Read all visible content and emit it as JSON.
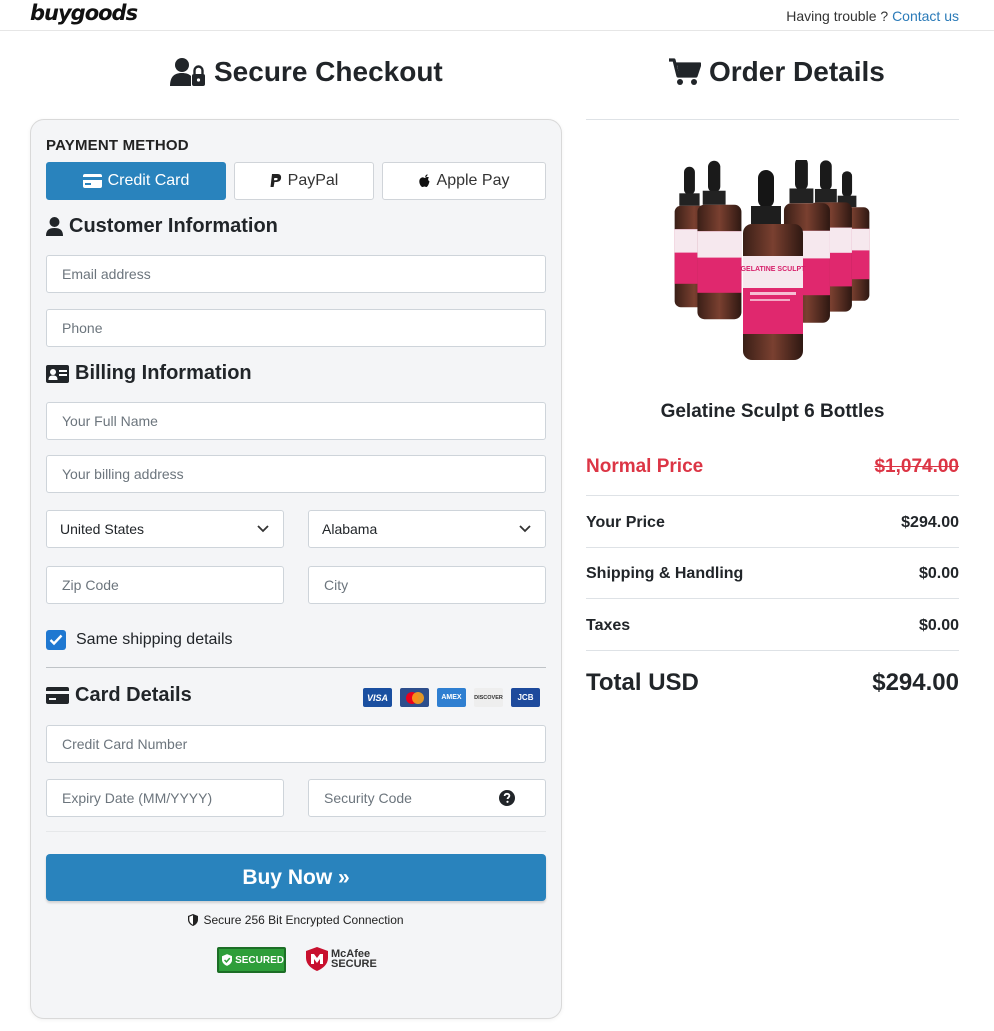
{
  "header": {
    "logo": "buygoods",
    "trouble_text": "Having trouble ?",
    "contact_link": "Contact us"
  },
  "checkout": {
    "title": "Secure Checkout",
    "payment_method_label": "PAYMENT METHOD",
    "payment_options": {
      "credit_card": "Credit Card",
      "paypal": "PayPal",
      "apple_pay": "Apple Pay"
    },
    "customer_info": {
      "title": "Customer Information",
      "email_placeholder": "Email address",
      "phone_placeholder": "Phone"
    },
    "billing_info": {
      "title": "Billing Information",
      "full_name_placeholder": "Your Full Name",
      "address_placeholder": "Your billing address",
      "country_value": "United States",
      "state_value": "Alabama",
      "zip_placeholder": "Zip Code",
      "city_placeholder": "City",
      "same_shipping_label": "Same shipping details",
      "same_shipping_checked": true
    },
    "card_details": {
      "title": "Card Details",
      "card_brands": [
        "VISA",
        "MC",
        "AMEX",
        "DISCOVER",
        "JCB"
      ],
      "card_number_placeholder": "Credit Card Number",
      "expiry_placeholder": "Expiry Date (MM/YYYY)",
      "security_placeholder": "Security Code"
    },
    "buy_button": "Buy Now »",
    "secure_text": "Secure 256 Bit Encrypted Connection",
    "trust_badges": {
      "secured": "SECURED",
      "mcafee": "McAfee SECURE"
    }
  },
  "order": {
    "title": "Order Details",
    "product_name": "Gelatine Sculpt 6 Bottles",
    "product_label": "GELATINE SCULPT",
    "rows": {
      "normal_price_label": "Normal Price",
      "normal_price_value": "$1,074.00",
      "your_price_label": "Your Price",
      "your_price_value": "$294.00",
      "shipping_label": "Shipping & Handling",
      "shipping_value": "$0.00",
      "taxes_label": "Taxes",
      "taxes_value": "$0.00",
      "total_label": "Total USD",
      "total_value": "$294.00"
    }
  },
  "colors": {
    "primary": "#2983bd",
    "danger": "#dc3545",
    "link": "#2a7ab8",
    "panel_bg": "#f4f5f7"
  }
}
